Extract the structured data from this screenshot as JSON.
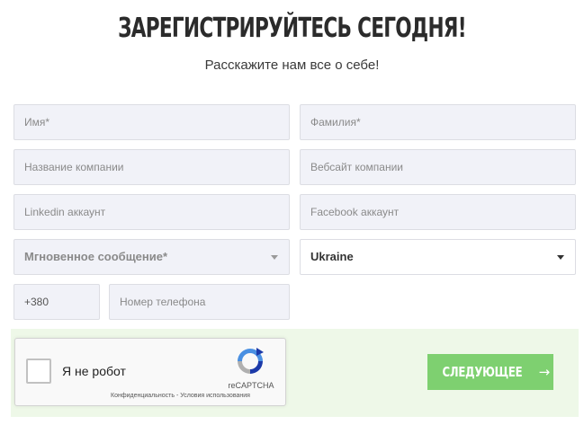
{
  "header": {
    "title": "ЗАРЕГИСТРИРУЙТЕСЬ СЕГОДНЯ!",
    "subtitle": "Расскажите нам все о себе!"
  },
  "form": {
    "first_name": {
      "placeholder": "Имя*"
    },
    "last_name": {
      "placeholder": "Фамилия*"
    },
    "company_name": {
      "placeholder": "Название компании"
    },
    "company_site": {
      "placeholder": "Вебсайт компании"
    },
    "linkedin": {
      "placeholder": "Linkedin аккаунт"
    },
    "facebook": {
      "placeholder": "Facebook аккаунт"
    },
    "messenger": {
      "value": "Мгновенное сообщение*"
    },
    "country": {
      "value": "Ukraine"
    },
    "phone_code": {
      "value": "+380"
    },
    "phone": {
      "placeholder": "Номер телефона"
    }
  },
  "captcha": {
    "label": "Я не робот",
    "brand": "reCAPTCHA",
    "links": "Конфиденциальность - Условия использования"
  },
  "actions": {
    "next_label": "СЛЕДУЮЩЕЕ",
    "next_arrow": "→"
  },
  "colors": {
    "field_bg": "#f1f2f8",
    "button_green": "#7ed070",
    "footer_band": "#eef8e8",
    "title_dark": "#2b2b2b"
  }
}
